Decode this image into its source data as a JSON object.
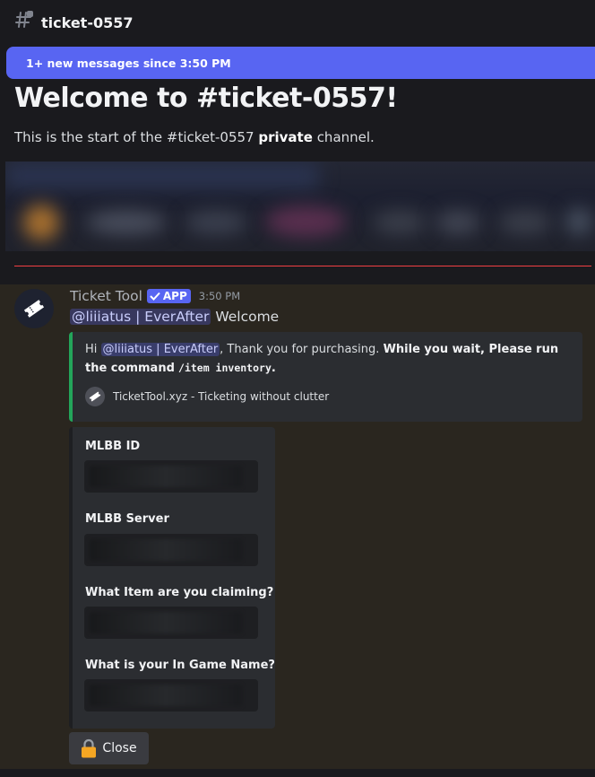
{
  "channel": {
    "title": "ticket-0557",
    "hash_icon": "threaded-channel-hash-icon"
  },
  "new_messages_bar": {
    "text": "1+ new messages since 3:50 PM"
  },
  "welcome": {
    "title": "Welcome to #ticket-0557!",
    "sub_prefix": "This is the start of the #ticket-0557",
    "sub_bold": "private",
    "sub_suffix": "channel."
  },
  "message": {
    "author": "Ticket Tool",
    "badge": "APP",
    "time": "3:50 PM",
    "mention": "@liiiatus | EverAfter",
    "text": "Welcome",
    "embed": {
      "hi": "Hi",
      "mention": "@liiiatus | EverAfter",
      "thanks": ", Thank you for purchasing.",
      "bold_1": "While you wait, Please run the command",
      "command": "/item inventory",
      "bold_end": ".",
      "footer": "TicketTool.xyz - Ticketing without clutter",
      "accent_color": "#23a55a"
    },
    "form": {
      "fields": [
        {
          "label": "MLBB ID"
        },
        {
          "label": "MLBB Server"
        },
        {
          "label": "What Item are you claiming?"
        },
        {
          "label": "What is your In Game Name?"
        }
      ]
    },
    "close_button": {
      "label": "Close",
      "icon": "lock-icon"
    }
  },
  "colors": {
    "brand": "#5865f2",
    "divider": "#f23f43"
  }
}
